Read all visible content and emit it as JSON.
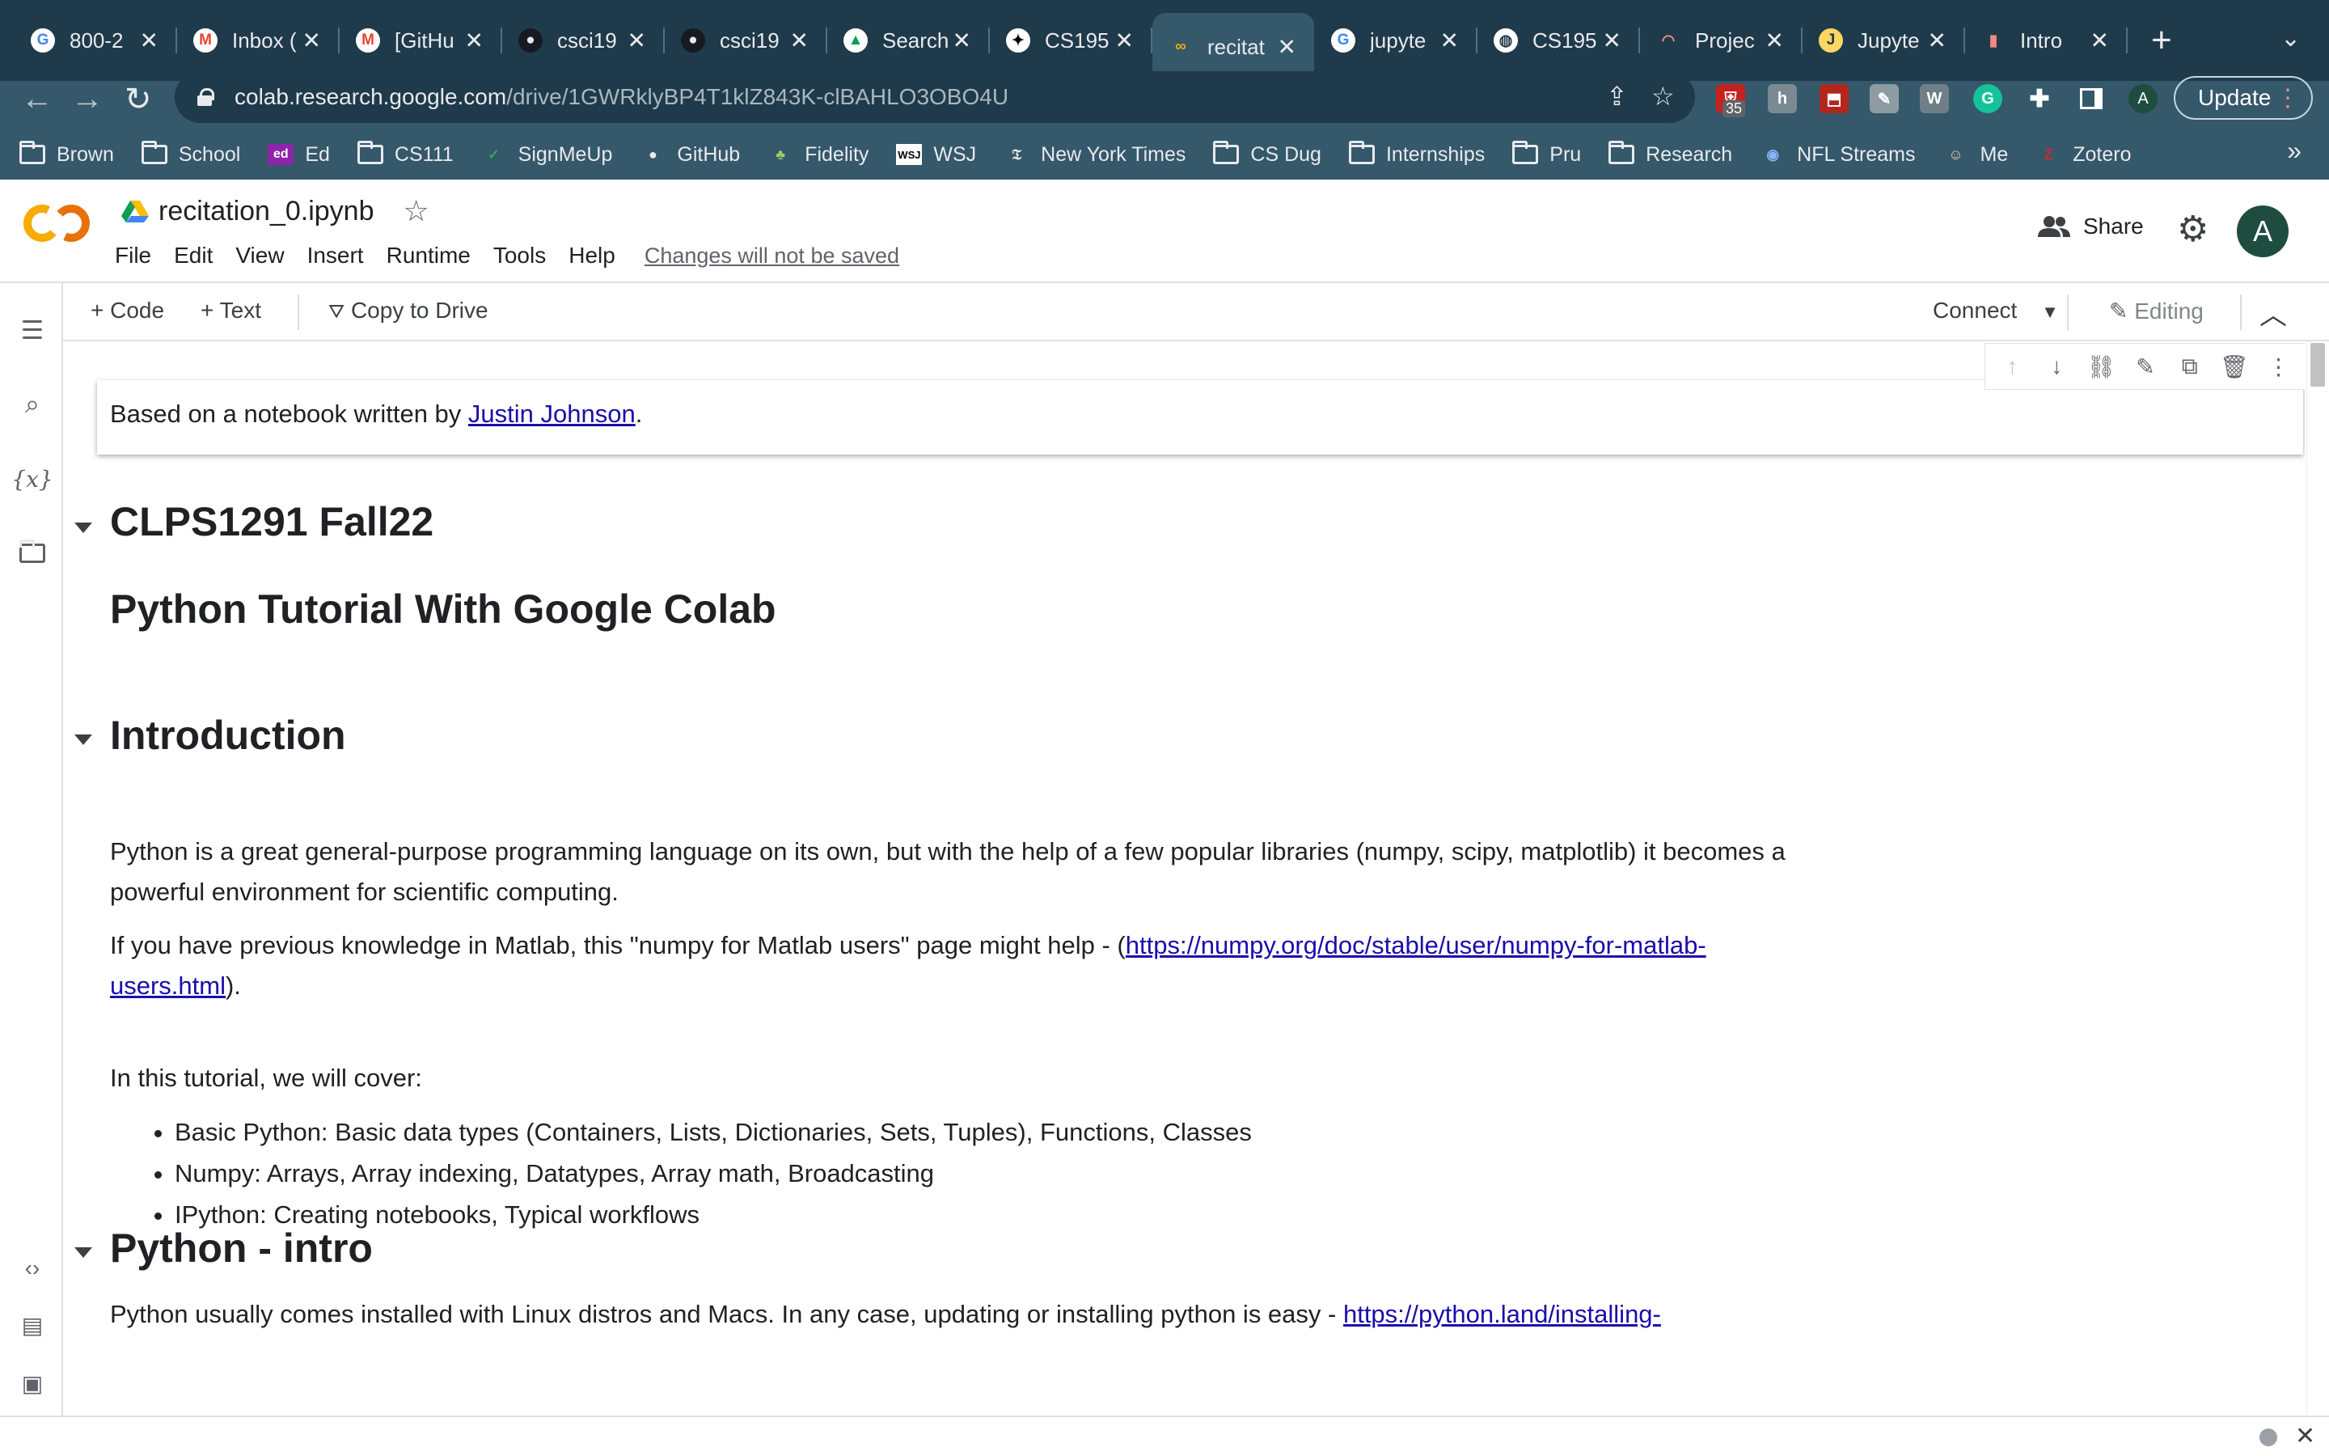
{
  "browser": {
    "tabs": [
      {
        "label": "800-2",
        "icon": "google-g-icon",
        "color": "#ffffff",
        "glyph": "G",
        "fg": "#4285f4"
      },
      {
        "label": "Inbox (",
        "icon": "gmail-icon",
        "color": "#ffffff",
        "glyph": "M",
        "fg": "#ea4335"
      },
      {
        "label": "[GitHu",
        "icon": "gmail-icon",
        "color": "#ffffff",
        "glyph": "M",
        "fg": "#ea4335"
      },
      {
        "label": "csci19",
        "icon": "github-icon",
        "color": "#161b22",
        "glyph": "●",
        "fg": "#e8eaed"
      },
      {
        "label": "csci19",
        "icon": "github-icon",
        "color": "#161b22",
        "glyph": "●",
        "fg": "#e8eaed"
      },
      {
        "label": "Search",
        "icon": "google-drive-icon",
        "color": "#ffffff",
        "glyph": "▲",
        "fg": "#0f9d58"
      },
      {
        "label": "CS195",
        "icon": "site-icon",
        "color": "#ffffff",
        "glyph": "✦",
        "fg": "#000000"
      },
      {
        "label": "recitat",
        "icon": "colab-icon",
        "color": "#35586b",
        "glyph": "∞",
        "fg": "#f9ab00",
        "active": true
      },
      {
        "label": "jupyte",
        "icon": "google-g-icon",
        "color": "#ffffff",
        "glyph": "G",
        "fg": "#4285f4"
      },
      {
        "label": "CS195",
        "icon": "globe-icon",
        "color": "#ffffff",
        "glyph": "◍",
        "fg": "#1f3a4a"
      },
      {
        "label": "Projec",
        "icon": "loading-icon",
        "color": "#1f3a4a",
        "glyph": "◠",
        "fg": "#f28b82"
      },
      {
        "label": "Jupyte",
        "icon": "jupyter-icon",
        "color": "#fdd663",
        "glyph": "J",
        "fg": "#1f3a4a"
      },
      {
        "label": "Intro",
        "icon": "book-icon",
        "color": "#1f3a4a",
        "glyph": "▮",
        "fg": "#f28b82"
      }
    ],
    "url_domain": "colab.research.google.com",
    "url_path": "/drive/1GWRklyBP4T1klZ843K-clBAHLO3OBO4U",
    "extension_badge": "35",
    "profile_initial": "A",
    "update_label": "Update",
    "bookmarks": [
      {
        "label": "Brown",
        "icon": "folder-icon"
      },
      {
        "label": "School",
        "icon": "folder-icon"
      },
      {
        "label": "Ed",
        "icon": "ed-icon"
      },
      {
        "label": "CS111",
        "icon": "folder-icon"
      },
      {
        "label": "SignMeUp",
        "icon": "signmeup-icon"
      },
      {
        "label": "GitHub",
        "icon": "github-icon"
      },
      {
        "label": "Fidelity",
        "icon": "fidelity-icon"
      },
      {
        "label": "WSJ",
        "icon": "wsj-icon"
      },
      {
        "label": "New York Times",
        "icon": "nyt-icon"
      },
      {
        "label": "CS Dug",
        "icon": "folder-icon"
      },
      {
        "label": "Internships",
        "icon": "folder-icon"
      },
      {
        "label": "Pru",
        "icon": "folder-icon"
      },
      {
        "label": "Research",
        "icon": "folder-icon"
      },
      {
        "label": "NFL Streams",
        "icon": "nfl-icon"
      },
      {
        "label": "Me",
        "icon": "avatar-icon"
      },
      {
        "label": "Zotero",
        "icon": "zotero-icon"
      }
    ],
    "bookmarks_more": "»"
  },
  "colab": {
    "title": "recitation_0.ipynb",
    "menu": [
      "File",
      "Edit",
      "View",
      "Insert",
      "Runtime",
      "Tools",
      "Help"
    ],
    "unsaved_notice": "Changes will not be saved",
    "share_label": "Share",
    "avatar_initial": "A",
    "toolbar": {
      "code_label": "+ Code",
      "text_label": "+ Text",
      "copy_label": "Copy to Drive",
      "connect_label": "Connect",
      "editing_label": "Editing"
    },
    "accent": "#f9ab00"
  },
  "notebook": {
    "focused_cell": {
      "prefix": "Based on a notebook written by ",
      "link": "Justin Johnson",
      "suffix": "."
    },
    "heading_course": "CLPS1291 Fall22",
    "heading_tutorial": "Python Tutorial With Google Colab",
    "heading_intro": "Introduction",
    "intro_p1": "Python is a great general-purpose programming language on its own, but with the help of a few popular libraries (numpy, scipy, matplotlib) it becomes a powerful environment for scientific computing.",
    "intro_p2_prefix": "If you have previous knowledge in Matlab, this \"numpy for Matlab users\" page might help - (",
    "intro_p2_link": "https://numpy.org/doc/stable/user/numpy-for-matlab-users.html",
    "intro_p2_suffix": ").",
    "intro_p3": "In this tutorial, we will cover:",
    "bullets": [
      "Basic Python: Basic data types (Containers, Lists, Dictionaries, Sets, Tuples), Functions, Classes",
      "Numpy: Arrays, Array indexing, Datatypes, Array math, Broadcasting",
      "IPython: Creating notebooks, Typical workflows"
    ],
    "heading_python": "Python - intro",
    "python_p1_prefix": "Python usually comes installed with Linux distros and Macs. In any case, updating or installing python is easy - ",
    "python_p1_link": "https://python.land/installing-"
  }
}
